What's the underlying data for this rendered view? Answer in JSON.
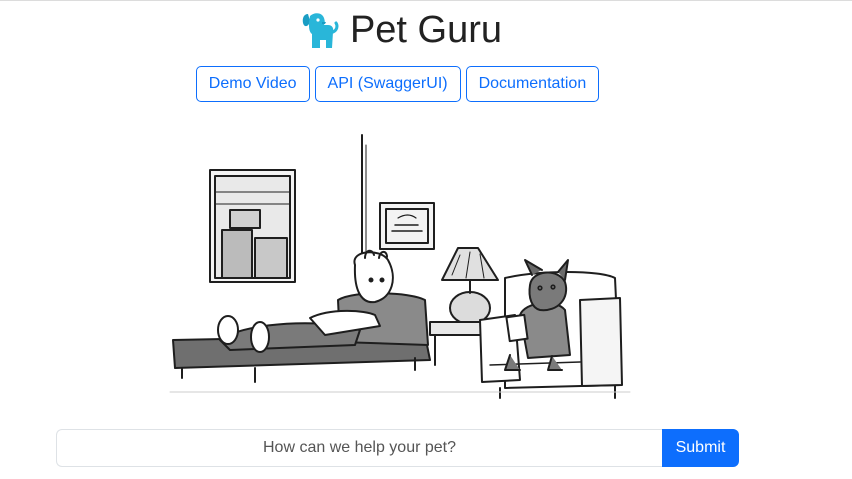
{
  "header": {
    "title": "Pet Guru",
    "logo_icon": "dog-icon",
    "logo_color": "#29b6d9"
  },
  "nav": {
    "buttons": [
      {
        "label": "Demo Video"
      },
      {
        "label": "API (SwaggerUI)"
      },
      {
        "label": "Documentation"
      }
    ]
  },
  "illustration": {
    "icon": "therapist-cartoon-illustration"
  },
  "search": {
    "placeholder": "How can we help your pet?",
    "value": "",
    "submit_label": "Submit"
  },
  "colors": {
    "accent": "#0d6efd",
    "text": "#222222"
  }
}
